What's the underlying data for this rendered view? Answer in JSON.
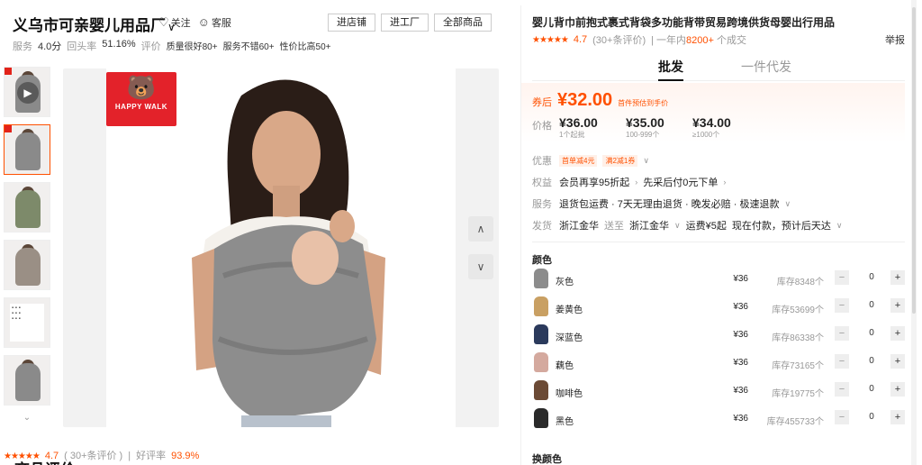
{
  "shop": {
    "name": "义乌市可亲婴儿用品厂",
    "follow_label": "关注",
    "service_label": "客服",
    "buttons": {
      "enter_shop": "进店铺",
      "enter_factory": "进工厂",
      "all_products": "全部商品"
    },
    "stats": {
      "service_label": "服务",
      "service_score": "4.0分",
      "repeat_label": "回头率",
      "repeat_rate": "51.16%",
      "eval_label": "评价",
      "tag1": "质量很好80+",
      "tag2": "服务不错60+",
      "tag3": "性价比高50+"
    }
  },
  "gallery": {
    "logo_text": "HAPPY WALK",
    "thumbnails": [
      "video",
      "front",
      "back",
      "side",
      "infographic",
      "model"
    ],
    "active_index": 1
  },
  "reviews": {
    "title": "商品评价",
    "score": "4.7",
    "count": "( 30+条评价 )",
    "separator": "|",
    "good_rate_label": "好评率",
    "good_rate": "93.9%"
  },
  "product": {
    "title": "婴儿背巾前抱式裹式背袋多功能背带贸易跨境供货母婴出行用品",
    "rating": "4.7",
    "rating_count": "(30+条评价)",
    "sold_prefix": "一年内",
    "sold_count": "8200+",
    "sold_suffix": "个成交",
    "report": "举报",
    "modes": {
      "wholesale": "批发",
      "dropship": "一件代发"
    },
    "coupon_label": "券后",
    "coupon_price": "¥32.00",
    "coupon_hint": "首件预估到手价",
    "price_label": "价格",
    "tiers": [
      {
        "price": "¥36.00",
        "qty": "1个起批"
      },
      {
        "price": "¥35.00",
        "qty": "100-999个"
      },
      {
        "price": "¥34.00",
        "qty": "≥1000个"
      }
    ],
    "promo_label": "优惠",
    "promo1": "首单减4元",
    "promo2": "满2减1券",
    "rights_label": "权益",
    "rights_value": "会员再享95折起",
    "rights_value2": "先采后付0元下单",
    "service_label": "服务",
    "services": "退货包运费 · 7天无理由退货 · 晚发必赔 · 极速退款",
    "ship_label": "发货",
    "ship_from": "浙江金华",
    "ship_to_word": "送至",
    "ship_to": "浙江金华",
    "ship_fee": "运费¥5起",
    "ship_time": "现在付款，预计后天达",
    "color_title": "颜色",
    "variants": [
      {
        "name": "灰色",
        "price": "¥36",
        "stock": "库存8348个",
        "qty": "0",
        "swatch": "#8c8c8c"
      },
      {
        "name": "姜黄色",
        "price": "¥36",
        "stock": "库存53699个",
        "qty": "0",
        "swatch": "#c9a063"
      },
      {
        "name": "深蓝色",
        "price": "¥36",
        "stock": "库存86338个",
        "qty": "0",
        "swatch": "#2b3a5c"
      },
      {
        "name": "藕色",
        "price": "¥36",
        "stock": "库存73165个",
        "qty": "0",
        "swatch": "#d4a99e"
      },
      {
        "name": "咖啡色",
        "price": "¥36",
        "stock": "库存19775个",
        "qty": "0",
        "swatch": "#6b4a35"
      },
      {
        "name": "黑色",
        "price": "¥36",
        "stock": "库存455733个",
        "qty": "0",
        "swatch": "#2a2a2a"
      }
    ],
    "swap_color_title": "换颜色"
  }
}
